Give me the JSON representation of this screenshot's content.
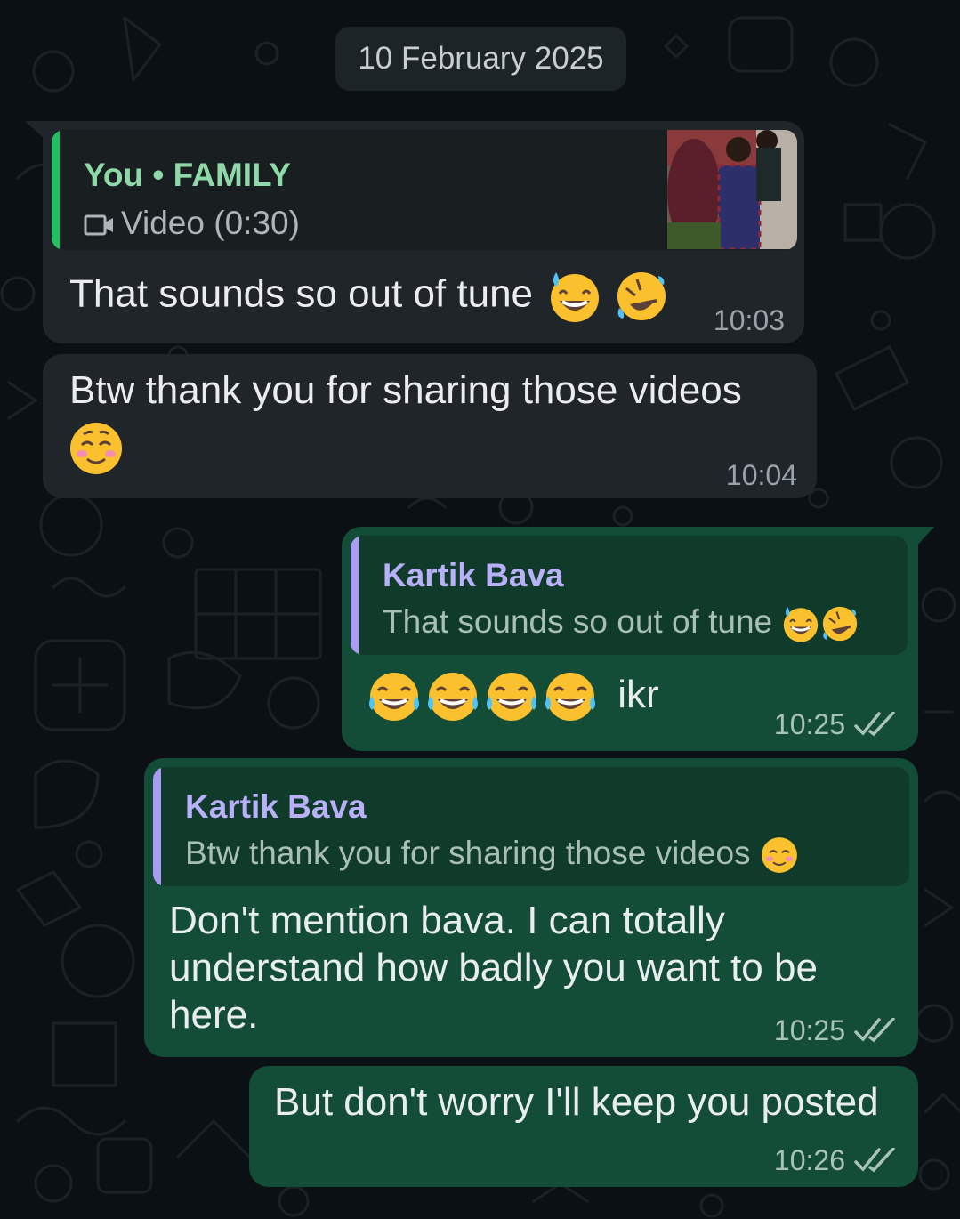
{
  "date_chip": "10 February 2025",
  "messages": [
    {
      "direction": "incoming",
      "quote": {
        "author_prefix": "You",
        "separator": "•",
        "author_group": "FAMILY",
        "media_label": "Video (0:30)",
        "media_icon": "video-camera-icon"
      },
      "text": "That sounds so out of tune",
      "emojis": [
        "grinning-sweat-emoji",
        "rolling-laughing-emoji"
      ],
      "time": "10:03"
    },
    {
      "direction": "incoming",
      "text": "Btw thank you for sharing those videos",
      "emojis": [
        "smiling-blush-emoji"
      ],
      "time": "10:04"
    },
    {
      "direction": "outgoing",
      "quote": {
        "author": "Kartik Bava",
        "text": "That sounds so out of tune",
        "emojis": [
          "grinning-sweat-emoji",
          "rolling-laughing-emoji"
        ]
      },
      "text": "ikr",
      "emojis": [
        "tears-of-joy-emoji",
        "tears-of-joy-emoji",
        "tears-of-joy-emoji",
        "tears-of-joy-emoji"
      ],
      "time": "10:25",
      "status": "read"
    },
    {
      "direction": "outgoing",
      "quote": {
        "author": "Kartik Bava",
        "text": "Btw thank you for sharing those videos",
        "emojis": [
          "smiling-blush-emoji"
        ]
      },
      "text_lines": [
        "Don't mention bava. I can totally",
        "understand how badly you want to be",
        "here."
      ],
      "time": "10:25",
      "status": "read"
    },
    {
      "direction": "outgoing",
      "text": "But don't worry I'll keep you posted",
      "time": "10:26",
      "status": "read"
    }
  ],
  "colors": {
    "background": "#0b1014",
    "incoming_bubble": "#1f2528",
    "outgoing_bubble": "#144d37",
    "quote_green": "#21c063",
    "quote_author_green": "#8fd9a8",
    "quote_purple": "#a99cf5",
    "read_ticks": "#a9c4b6"
  }
}
